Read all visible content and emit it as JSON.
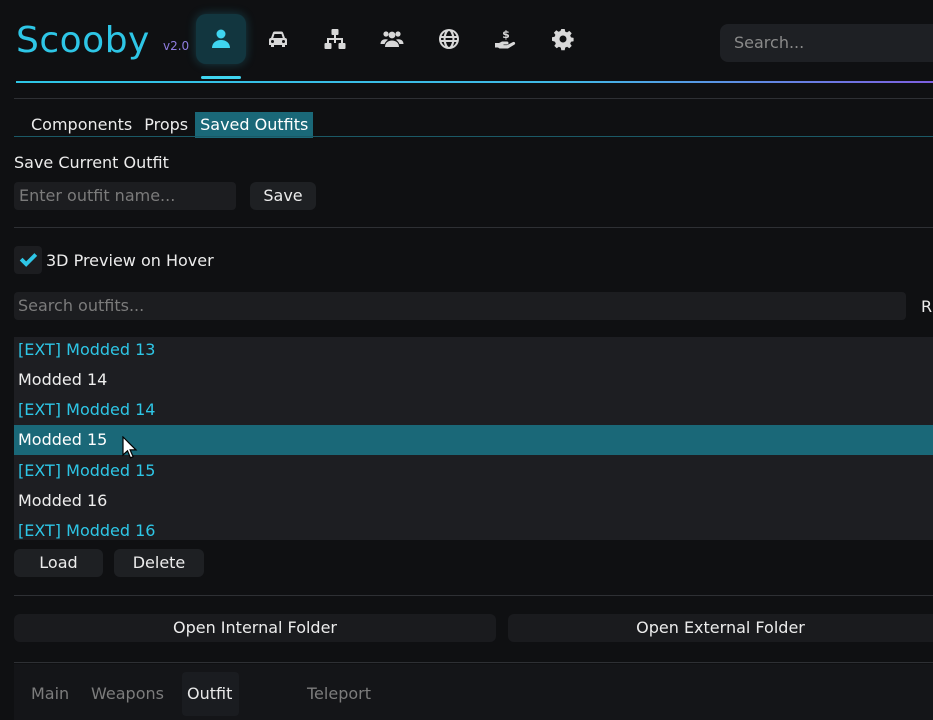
{
  "header": {
    "logo": "Scooby",
    "version": "v2.0",
    "nav": [
      {
        "icon": "user-icon",
        "active": true
      },
      {
        "icon": "car-icon",
        "active": false
      },
      {
        "icon": "network-icon",
        "active": false
      },
      {
        "icon": "users-icon",
        "active": false
      },
      {
        "icon": "globe-icon",
        "active": false
      },
      {
        "icon": "money-hand-icon",
        "active": false
      },
      {
        "icon": "gear-icon",
        "active": false
      }
    ],
    "search_placeholder": "Search..."
  },
  "sub_tabs": [
    {
      "label": "Components",
      "active": false
    },
    {
      "label": "Props",
      "active": false
    },
    {
      "label": "Saved Outfits",
      "active": true
    }
  ],
  "save_section": {
    "title": "Save Current Outfit",
    "input_placeholder": "Enter outfit name...",
    "save_label": "Save"
  },
  "preview": {
    "label": "3D Preview on Hover",
    "checked": true
  },
  "outfit_search": {
    "placeholder": "Search outfits...",
    "right_label": "R"
  },
  "outfits": [
    {
      "name": "[EXT] Modded 13",
      "external": true,
      "selected": false
    },
    {
      "name": "Modded 14",
      "external": false,
      "selected": false
    },
    {
      "name": "[EXT] Modded 14",
      "external": true,
      "selected": false
    },
    {
      "name": "Modded 15",
      "external": false,
      "selected": true
    },
    {
      "name": "[EXT] Modded 15",
      "external": true,
      "selected": false
    },
    {
      "name": "Modded 16",
      "external": false,
      "selected": false
    },
    {
      "name": "[EXT] Modded 16",
      "external": true,
      "selected": false
    }
  ],
  "actions": {
    "load_label": "Load",
    "delete_label": "Delete",
    "open_internal_label": "Open Internal Folder",
    "open_external_label": "Open External Folder"
  },
  "bottom_tabs": [
    {
      "label": "Main",
      "active": false
    },
    {
      "label": "Weapons",
      "active": false
    },
    {
      "label": "Outfit Editor",
      "active": true
    },
    {
      "label": "Teleport",
      "active": false
    }
  ],
  "colors": {
    "accent": "#2ec6e6",
    "selected_row": "#1a6878",
    "version": "#8f7ce0"
  }
}
